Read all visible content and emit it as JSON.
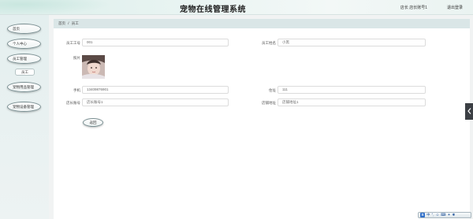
{
  "header": {
    "title": "宠物在线管理系统",
    "account": "店长 店长账号1",
    "logout": "退出登录"
  },
  "sidebar": {
    "items": [
      {
        "label": "首页"
      },
      {
        "label": "个人中心"
      },
      {
        "label": "员工管理"
      },
      {
        "label": "宠物用品管理"
      },
      {
        "label": "宠物设备管理"
      }
    ],
    "sub_items": [
      {
        "label": "员工"
      }
    ]
  },
  "breadcrumb": {
    "home": "首页",
    "separator": "/",
    "current": "员工"
  },
  "form": {
    "employee_no": {
      "label": "员工工号",
      "value": "001"
    },
    "employee_name": {
      "label": "员工姓名",
      "value": "小黑"
    },
    "photo": {
      "label": "照片"
    },
    "phone": {
      "label": "手机",
      "value": "13409876901"
    },
    "address": {
      "label": "住址",
      "value": "111"
    },
    "store_account": {
      "label": "店长账号",
      "value": "店长账号1"
    },
    "store_address": {
      "label": "店铺地址",
      "value": "店铺地址1"
    },
    "back_button": "返回"
  },
  "ime": {
    "items": [
      "中",
      "°,",
      "☺",
      "⌨",
      "✦",
      "✱"
    ]
  },
  "colors": {
    "breadcrumb_bg": "#dae6e7",
    "sidebar_bg": "#e4efef",
    "edge_tab": "#3b3f44"
  }
}
